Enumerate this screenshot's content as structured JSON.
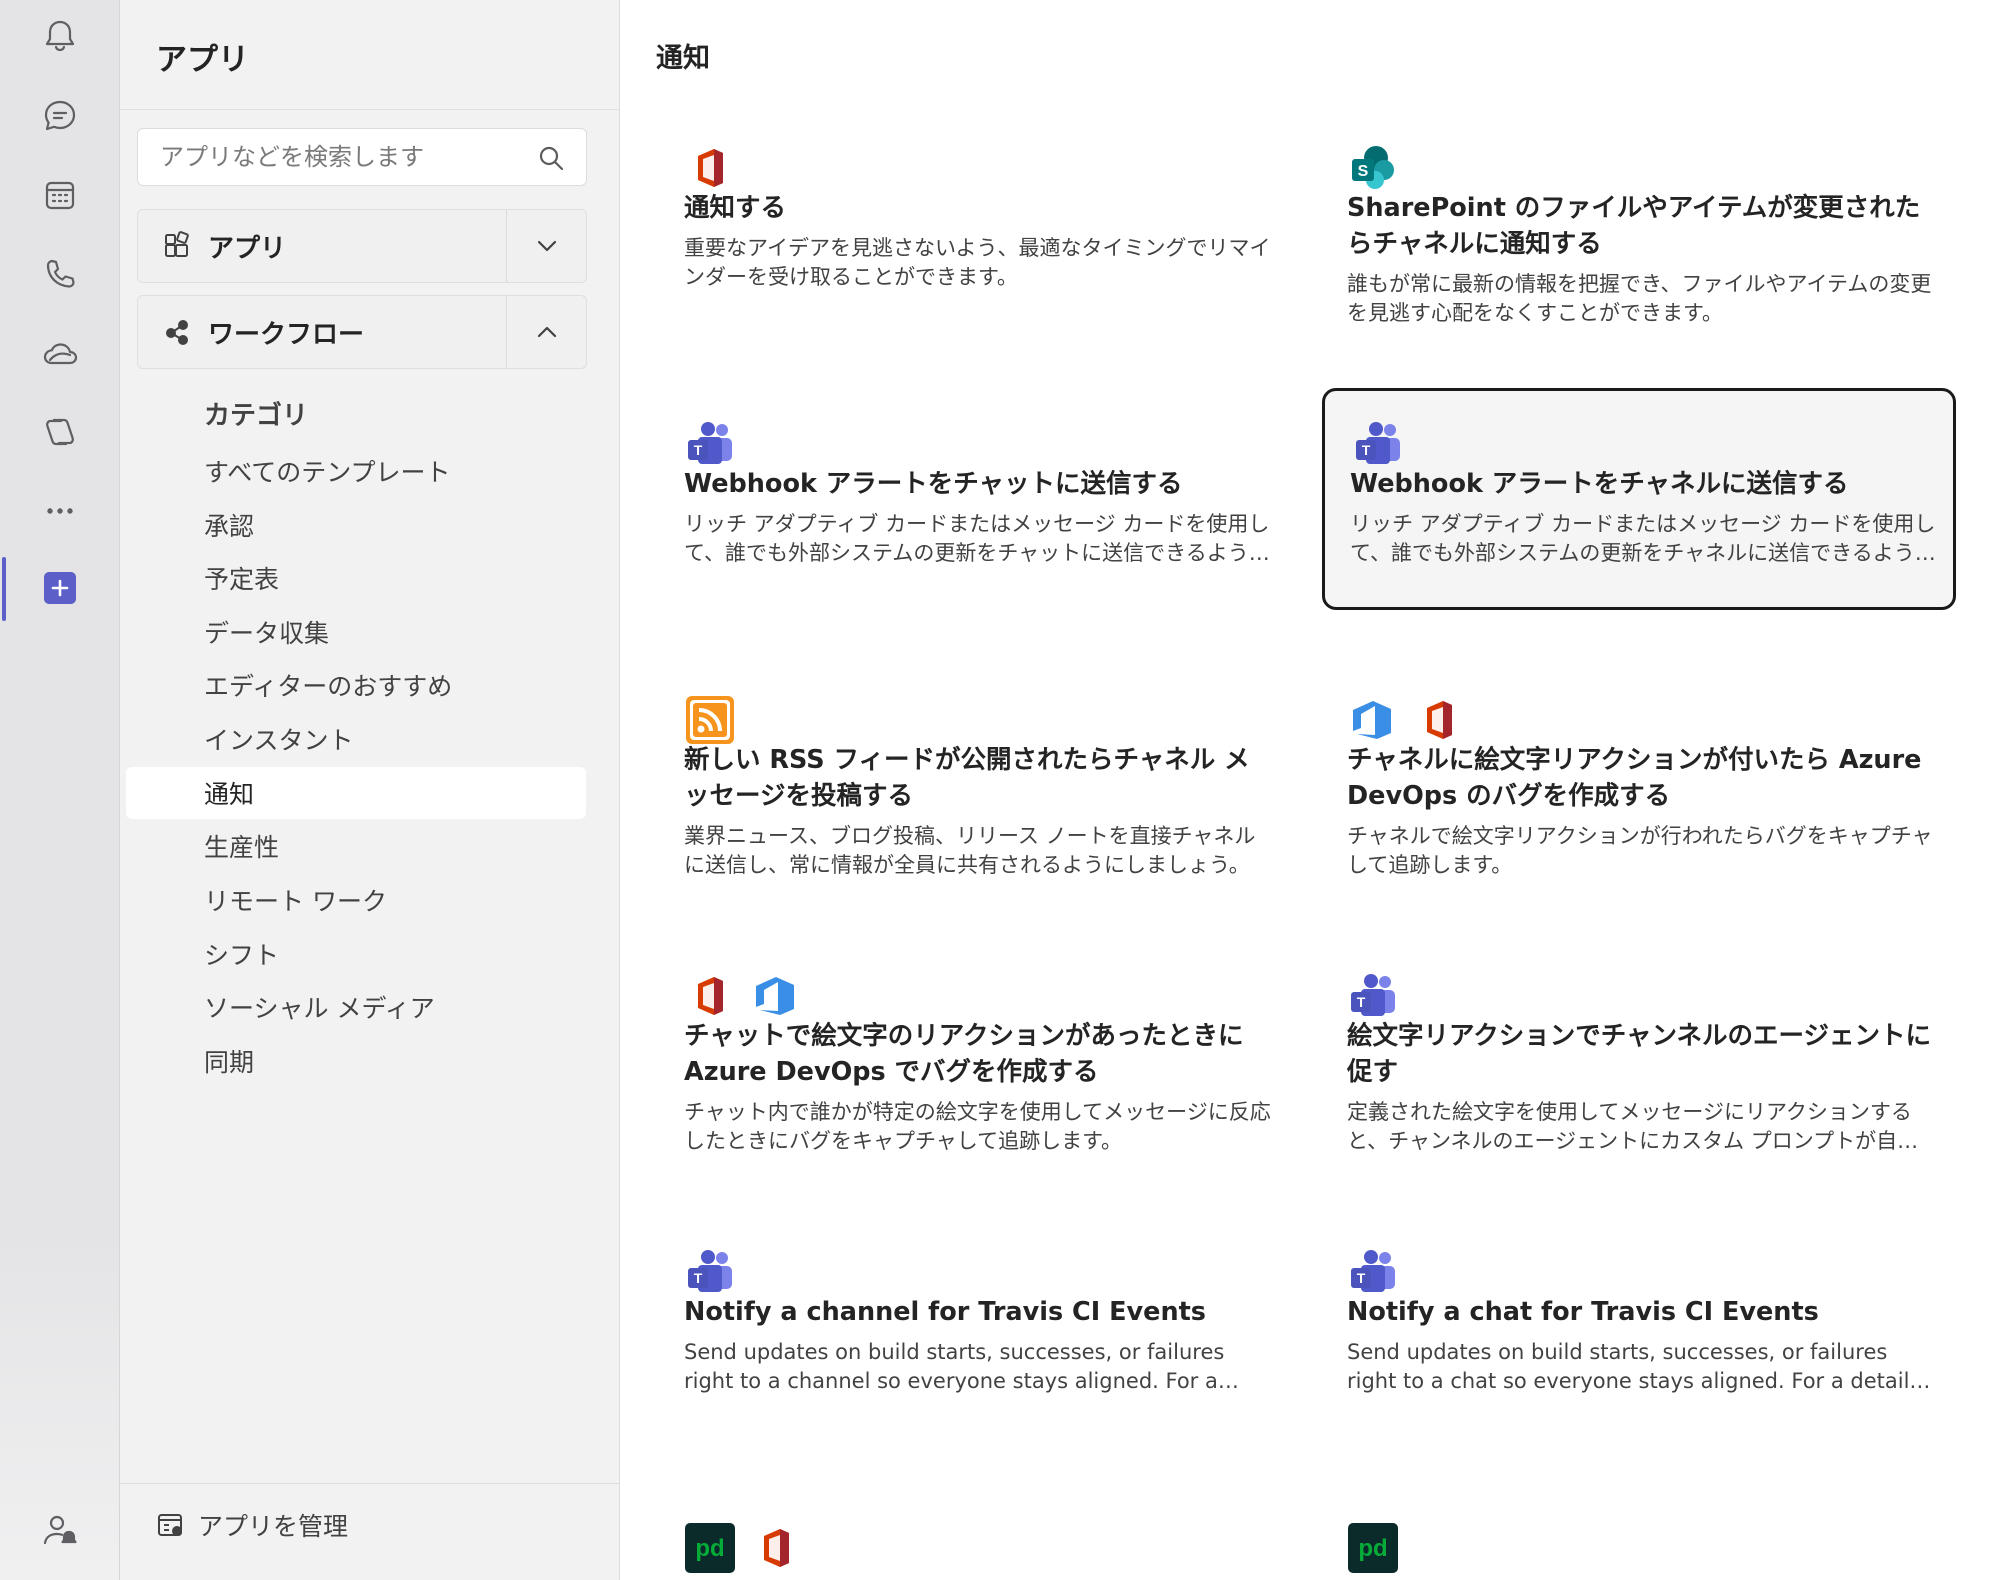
{
  "rail": {
    "items": [
      {
        "name": "activity",
        "icon": "bell-icon"
      },
      {
        "name": "chat",
        "icon": "chat-icon"
      },
      {
        "name": "calendar",
        "icon": "calendar-icon"
      },
      {
        "name": "calls",
        "icon": "phone-icon"
      },
      {
        "name": "onedrive",
        "icon": "cloud-icon"
      },
      {
        "name": "copilot",
        "icon": "copilot-icon"
      },
      {
        "name": "more",
        "icon": "more-icon"
      },
      {
        "name": "apps",
        "icon": "plus-icon",
        "active": true
      }
    ],
    "bottom_icon": "person-bell-icon"
  },
  "sidebar": {
    "title": "アプリ",
    "search": {
      "placeholder": "アプリなどを検索します",
      "value": ""
    },
    "sections": [
      {
        "label": "アプリ",
        "icon": "apps-grid-icon",
        "expanded": false
      },
      {
        "label": "ワークフロー",
        "icon": "workflow-icon",
        "expanded": true
      }
    ],
    "category_heading": "カテゴリ",
    "categories": [
      {
        "label": "すべてのテンプレート"
      },
      {
        "label": "承認"
      },
      {
        "label": "予定表"
      },
      {
        "label": "データ収集"
      },
      {
        "label": "エディターのおすすめ"
      },
      {
        "label": "インスタント"
      },
      {
        "label": "通知",
        "selected": true
      },
      {
        "label": "生産性"
      },
      {
        "label": "リモート ワーク"
      },
      {
        "label": "シフト"
      },
      {
        "label": "ソーシャル メディア"
      },
      {
        "label": "同期"
      }
    ],
    "manage_label": "アプリを管理"
  },
  "main": {
    "title": "通知",
    "cards": [
      {
        "icons": [
          "office-icon"
        ],
        "title": "通知する",
        "desc": "重要なアイデアを見逃さないよう、最適なタイミングでリマインダーを受け取ることができます。"
      },
      {
        "icons": [
          "sharepoint-icon"
        ],
        "title": "SharePoint のファイルやアイテムが変更されたらチャネルに通知する",
        "desc": "誰もが常に最新の情報を把握でき、ファイルやアイテムの変更を見逃す心配をなくすことができます。"
      },
      {
        "icons": [
          "teams-icon"
        ],
        "title": "Webhook アラートをチャットに送信する",
        "desc": "リッチ アダプティブ カードまたはメッセージ カードを使用して、誰でも外部システムの更新をチャットに送信できるようにします。"
      },
      {
        "icons": [
          "teams-icon"
        ],
        "title": "Webhook アラートをチャネルに送信する",
        "focused": true,
        "desc": "リッチ アダプティブ カードまたはメッセージ カードを使用して、誰でも外部システムの更新をチャネルに送信できるようにします。"
      },
      {
        "icons": [
          "rss-icon"
        ],
        "title": "新しい RSS フィードが公開されたらチャネル メッセージを投稿する",
        "desc": "業界ニュース、ブログ投稿、リリース ノートを直接チャネルに送信し、常に情報が全員に共有されるようにしましょう。"
      },
      {
        "icons": [
          "azure-devops-icon",
          "office-icon"
        ],
        "title": "チャネルに絵文字リアクションが付いたら Azure DevOps のバグを作成する",
        "desc": "チャネルで絵文字リアクションが行われたらバグをキャプチャして追跡します。"
      },
      {
        "icons": [
          "office-icon",
          "azure-devops-icon"
        ],
        "title": "チャットで絵文字のリアクションがあったときに Azure DevOps でバグを作成する",
        "desc": "チャット内で誰かが特定の絵文字を使用してメッセージに反応したときにバグをキャプチャして追跡します。"
      },
      {
        "icons": [
          "teams-icon"
        ],
        "title": "絵文字リアクションでチャンネルのエージェントに促す",
        "desc": "定義された絵文字を使用してメッセージにリアクションすると、チャンネルのエージェントにカスタム プロンプトが自動的に送信されます。"
      },
      {
        "icons": [
          "teams-icon"
        ],
        "title": "Notify a channel for Travis CI Events",
        "desc": "Send updates on build starts, successes, or failures right to a channel so everyone stays aligned. For a detailed guide, see the documentation."
      },
      {
        "icons": [
          "teams-icon"
        ],
        "title": "Notify a chat for Travis CI Events",
        "desc": "Send updates on build starts, successes, or failures right to a chat so everyone stays aligned. For a detailed guide, see the documentation."
      },
      {
        "icons": [
          "pagerduty-icon",
          "office-icon"
        ],
        "title": "",
        "desc": ""
      },
      {
        "icons": [
          "pagerduty-icon"
        ],
        "title": "",
        "desc": ""
      }
    ]
  },
  "colors": {
    "accent": "#5b5fc7",
    "sidebar_bg": "#f2f2f2",
    "rail_bg": "#e4e4e6",
    "focus_border": "#1a1a1a"
  }
}
